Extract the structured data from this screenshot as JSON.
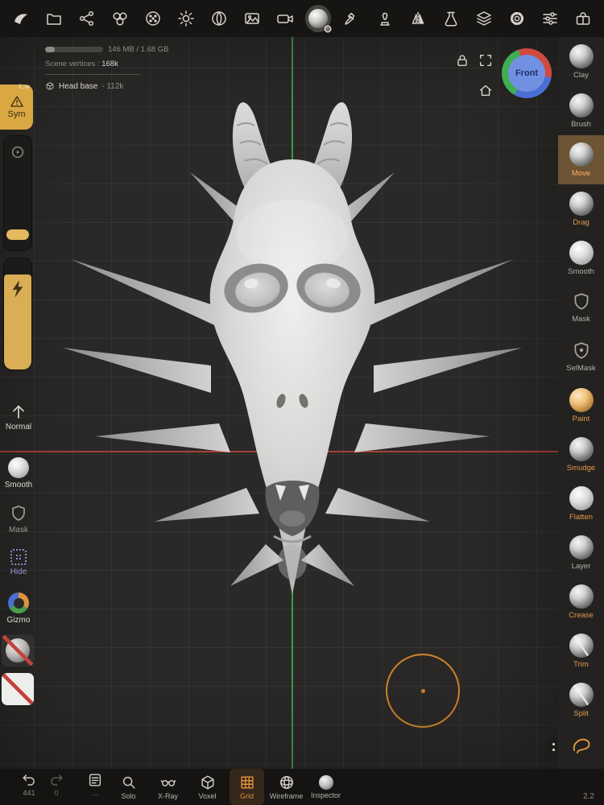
{
  "app": {
    "version": "2.2"
  },
  "header": {
    "memory_text": "146 MB / 1.68 GB",
    "vertices_label": "Scene vertices :",
    "vertices_value": "168k",
    "object_name": "Head base",
    "object_vertices": "- 112k",
    "view_label": "Front"
  },
  "left_panel": {
    "overlay_label": "L.w",
    "sym_label": "Sym",
    "items": [
      {
        "label": "Normal"
      },
      {
        "label": "Smooth"
      },
      {
        "label": "Mask"
      },
      {
        "label": "Hide"
      },
      {
        "label": "Gizmo"
      }
    ]
  },
  "right_panel": {
    "tools": [
      {
        "label": "Clay"
      },
      {
        "label": "Brush"
      },
      {
        "label": "Move"
      },
      {
        "label": "Drag"
      },
      {
        "label": "Smooth"
      },
      {
        "label": "Mask"
      },
      {
        "label": "SelMask"
      },
      {
        "label": "Paint"
      },
      {
        "label": "Smudge"
      },
      {
        "label": "Flatten"
      },
      {
        "label": "Layer"
      },
      {
        "label": "Crease"
      },
      {
        "label": "Trim"
      },
      {
        "label": "Split"
      }
    ]
  },
  "bottom_bar": {
    "undo_count": "441",
    "redo_count": "0",
    "history_more": "...",
    "items": [
      {
        "label": "Solo"
      },
      {
        "label": "X-Ray"
      },
      {
        "label": "Voxel"
      },
      {
        "label": "Grid"
      },
      {
        "label": "Wireframe"
      },
      {
        "label": "Inspector"
      }
    ]
  },
  "colors": {
    "accent_orange": "#e0913f",
    "slider_yellow": "#e5b95f",
    "axis_green": "#3fae53",
    "axis_red": "#c9463c",
    "gizmo_blue": "#7290e2",
    "selected_tool_bg": "#6d5434"
  }
}
